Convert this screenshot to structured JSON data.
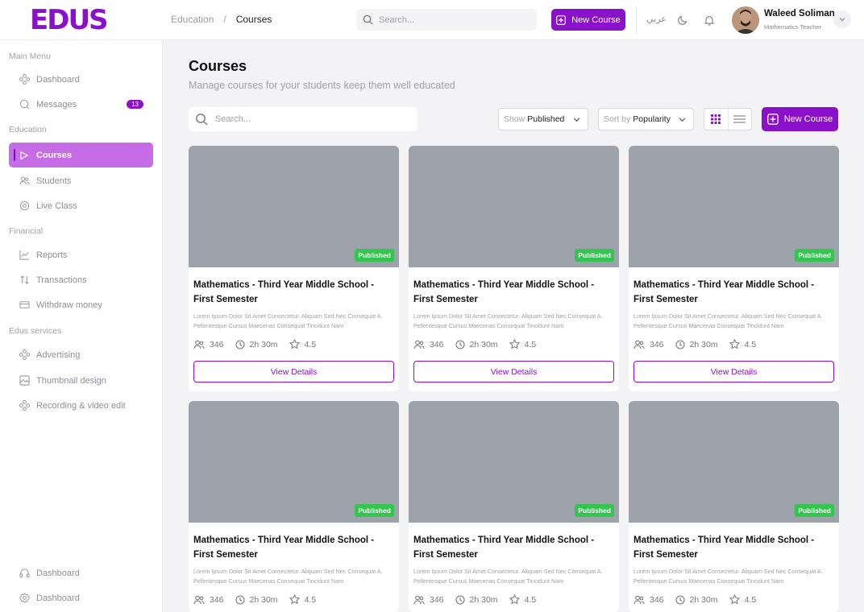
{
  "brand": {
    "logo": "EDUS",
    "accent": "#8a10c9"
  },
  "breadcrumb": [
    "Education",
    "Courses"
  ],
  "top_search_placeholder": "Search...",
  "top_new_course": "New Course",
  "language": "عربي",
  "user": {
    "name": "Waleed Soliman",
    "role": "Mathematics Teacher"
  },
  "sidebar": {
    "section_main": "Main Menu",
    "dashboard": "Dashboard",
    "messages": "Messages",
    "messages_count": "13",
    "section_education": "Education",
    "courses": "Courses",
    "students": "Students",
    "live_class": "Live Class",
    "section_financial": "Financial",
    "reports": "Reports",
    "transactions": "Transactions",
    "withdraw": "Withdraw money",
    "section_services": "Edus services",
    "advertising": "Advertising",
    "thumbnail": "Thumbnail design",
    "recording": "Recording & video edit",
    "bottom_1": "Dashboard",
    "bottom_2": "Dashboard"
  },
  "page": {
    "title": "Courses",
    "subtitle": "Manage courses for your students keep them well educated",
    "search_placeholder": "Search...",
    "show_label": "Show",
    "show_value": "Published",
    "sort_label": "Sort by",
    "sort_value": "Popularity",
    "new_course": "New Course"
  },
  "course": {
    "badge": "Published",
    "title": "Mathematics - Third Year Middle School - First Semester",
    "description": "Lorem Ipsum Dolor Sit Amet Consectetur. Aliquam Sed Nec Consequat A. Pellentesque Cursus Maecenas Consequat Tincidunt Nam",
    "students": "346",
    "duration": "2h 30m",
    "rating": "4.5",
    "button": "View Details"
  }
}
